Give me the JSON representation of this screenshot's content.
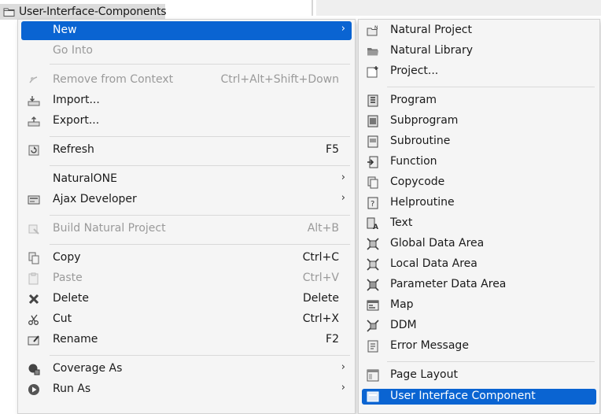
{
  "tree": {
    "label": "User-Interface-Components"
  },
  "main_menu": {
    "items": [
      {
        "label": "New",
        "shortcut": "",
        "submenu": true,
        "disabled": false,
        "selected": true,
        "icon": "none"
      },
      {
        "label": "Go Into",
        "shortcut": "",
        "submenu": false,
        "disabled": true,
        "icon": "none"
      },
      {
        "label": "Remove from Context",
        "shortcut": "Ctrl+Alt+Shift+Down",
        "submenu": false,
        "disabled": true,
        "icon": "remove-context-icon"
      },
      {
        "label": "Import...",
        "shortcut": "",
        "submenu": false,
        "disabled": false,
        "icon": "import-icon"
      },
      {
        "label": "Export...",
        "shortcut": "",
        "submenu": false,
        "disabled": false,
        "icon": "export-icon"
      },
      {
        "label": "Refresh",
        "shortcut": "F5",
        "submenu": false,
        "disabled": false,
        "icon": "refresh-icon"
      },
      {
        "label": "NaturalONE",
        "shortcut": "",
        "submenu": true,
        "disabled": false,
        "icon": "none"
      },
      {
        "label": "Ajax Developer",
        "shortcut": "",
        "submenu": true,
        "disabled": false,
        "icon": "ajax-icon"
      },
      {
        "label": "Build Natural Project",
        "shortcut": "Alt+B",
        "submenu": false,
        "disabled": true,
        "icon": "build-icon"
      },
      {
        "label": "Copy",
        "shortcut": "Ctrl+C",
        "submenu": false,
        "disabled": false,
        "icon": "copy-icon"
      },
      {
        "label": "Paste",
        "shortcut": "Ctrl+V",
        "submenu": false,
        "disabled": true,
        "icon": "paste-icon"
      },
      {
        "label": "Delete",
        "shortcut": "Delete",
        "submenu": false,
        "disabled": false,
        "icon": "delete-icon"
      },
      {
        "label": "Cut",
        "shortcut": "Ctrl+X",
        "submenu": false,
        "disabled": false,
        "icon": "cut-icon"
      },
      {
        "label": "Rename",
        "shortcut": "F2",
        "submenu": false,
        "disabled": false,
        "icon": "rename-icon"
      },
      {
        "label": "Coverage As",
        "shortcut": "",
        "submenu": true,
        "disabled": false,
        "icon": "coverage-icon"
      },
      {
        "label": "Run As",
        "shortcut": "",
        "submenu": true,
        "disabled": false,
        "icon": "run-icon"
      }
    ]
  },
  "sub_menu": {
    "items": [
      {
        "label": "Natural Project",
        "icon": "natural-project-icon"
      },
      {
        "label": "Natural Library",
        "icon": "folder-icon"
      },
      {
        "label": "Project...",
        "icon": "project-icon"
      },
      {
        "label": "Program",
        "icon": "program-icon"
      },
      {
        "label": "Subprogram",
        "icon": "subprogram-icon"
      },
      {
        "label": "Subroutine",
        "icon": "subroutine-icon"
      },
      {
        "label": "Function",
        "icon": "function-icon"
      },
      {
        "label": "Copycode",
        "icon": "copycode-icon"
      },
      {
        "label": "Helproutine",
        "icon": "helproutine-icon"
      },
      {
        "label": "Text",
        "icon": "text-icon"
      },
      {
        "label": "Global Data Area",
        "icon": "data-area-icon"
      },
      {
        "label": "Local Data Area",
        "icon": "data-area-icon"
      },
      {
        "label": "Parameter Data Area",
        "icon": "data-area-icon"
      },
      {
        "label": "Map",
        "icon": "map-icon"
      },
      {
        "label": "DDM",
        "icon": "ddm-icon"
      },
      {
        "label": "Error Message",
        "icon": "error-message-icon"
      },
      {
        "label": "Page Layout",
        "icon": "page-layout-icon"
      },
      {
        "label": "User Interface Component",
        "icon": "ui-component-icon",
        "selected": true
      }
    ]
  },
  "colors": {
    "selection": "#0a64d2",
    "menu_bg": "#f5f5f5",
    "disabled": "#9a9a9a"
  }
}
